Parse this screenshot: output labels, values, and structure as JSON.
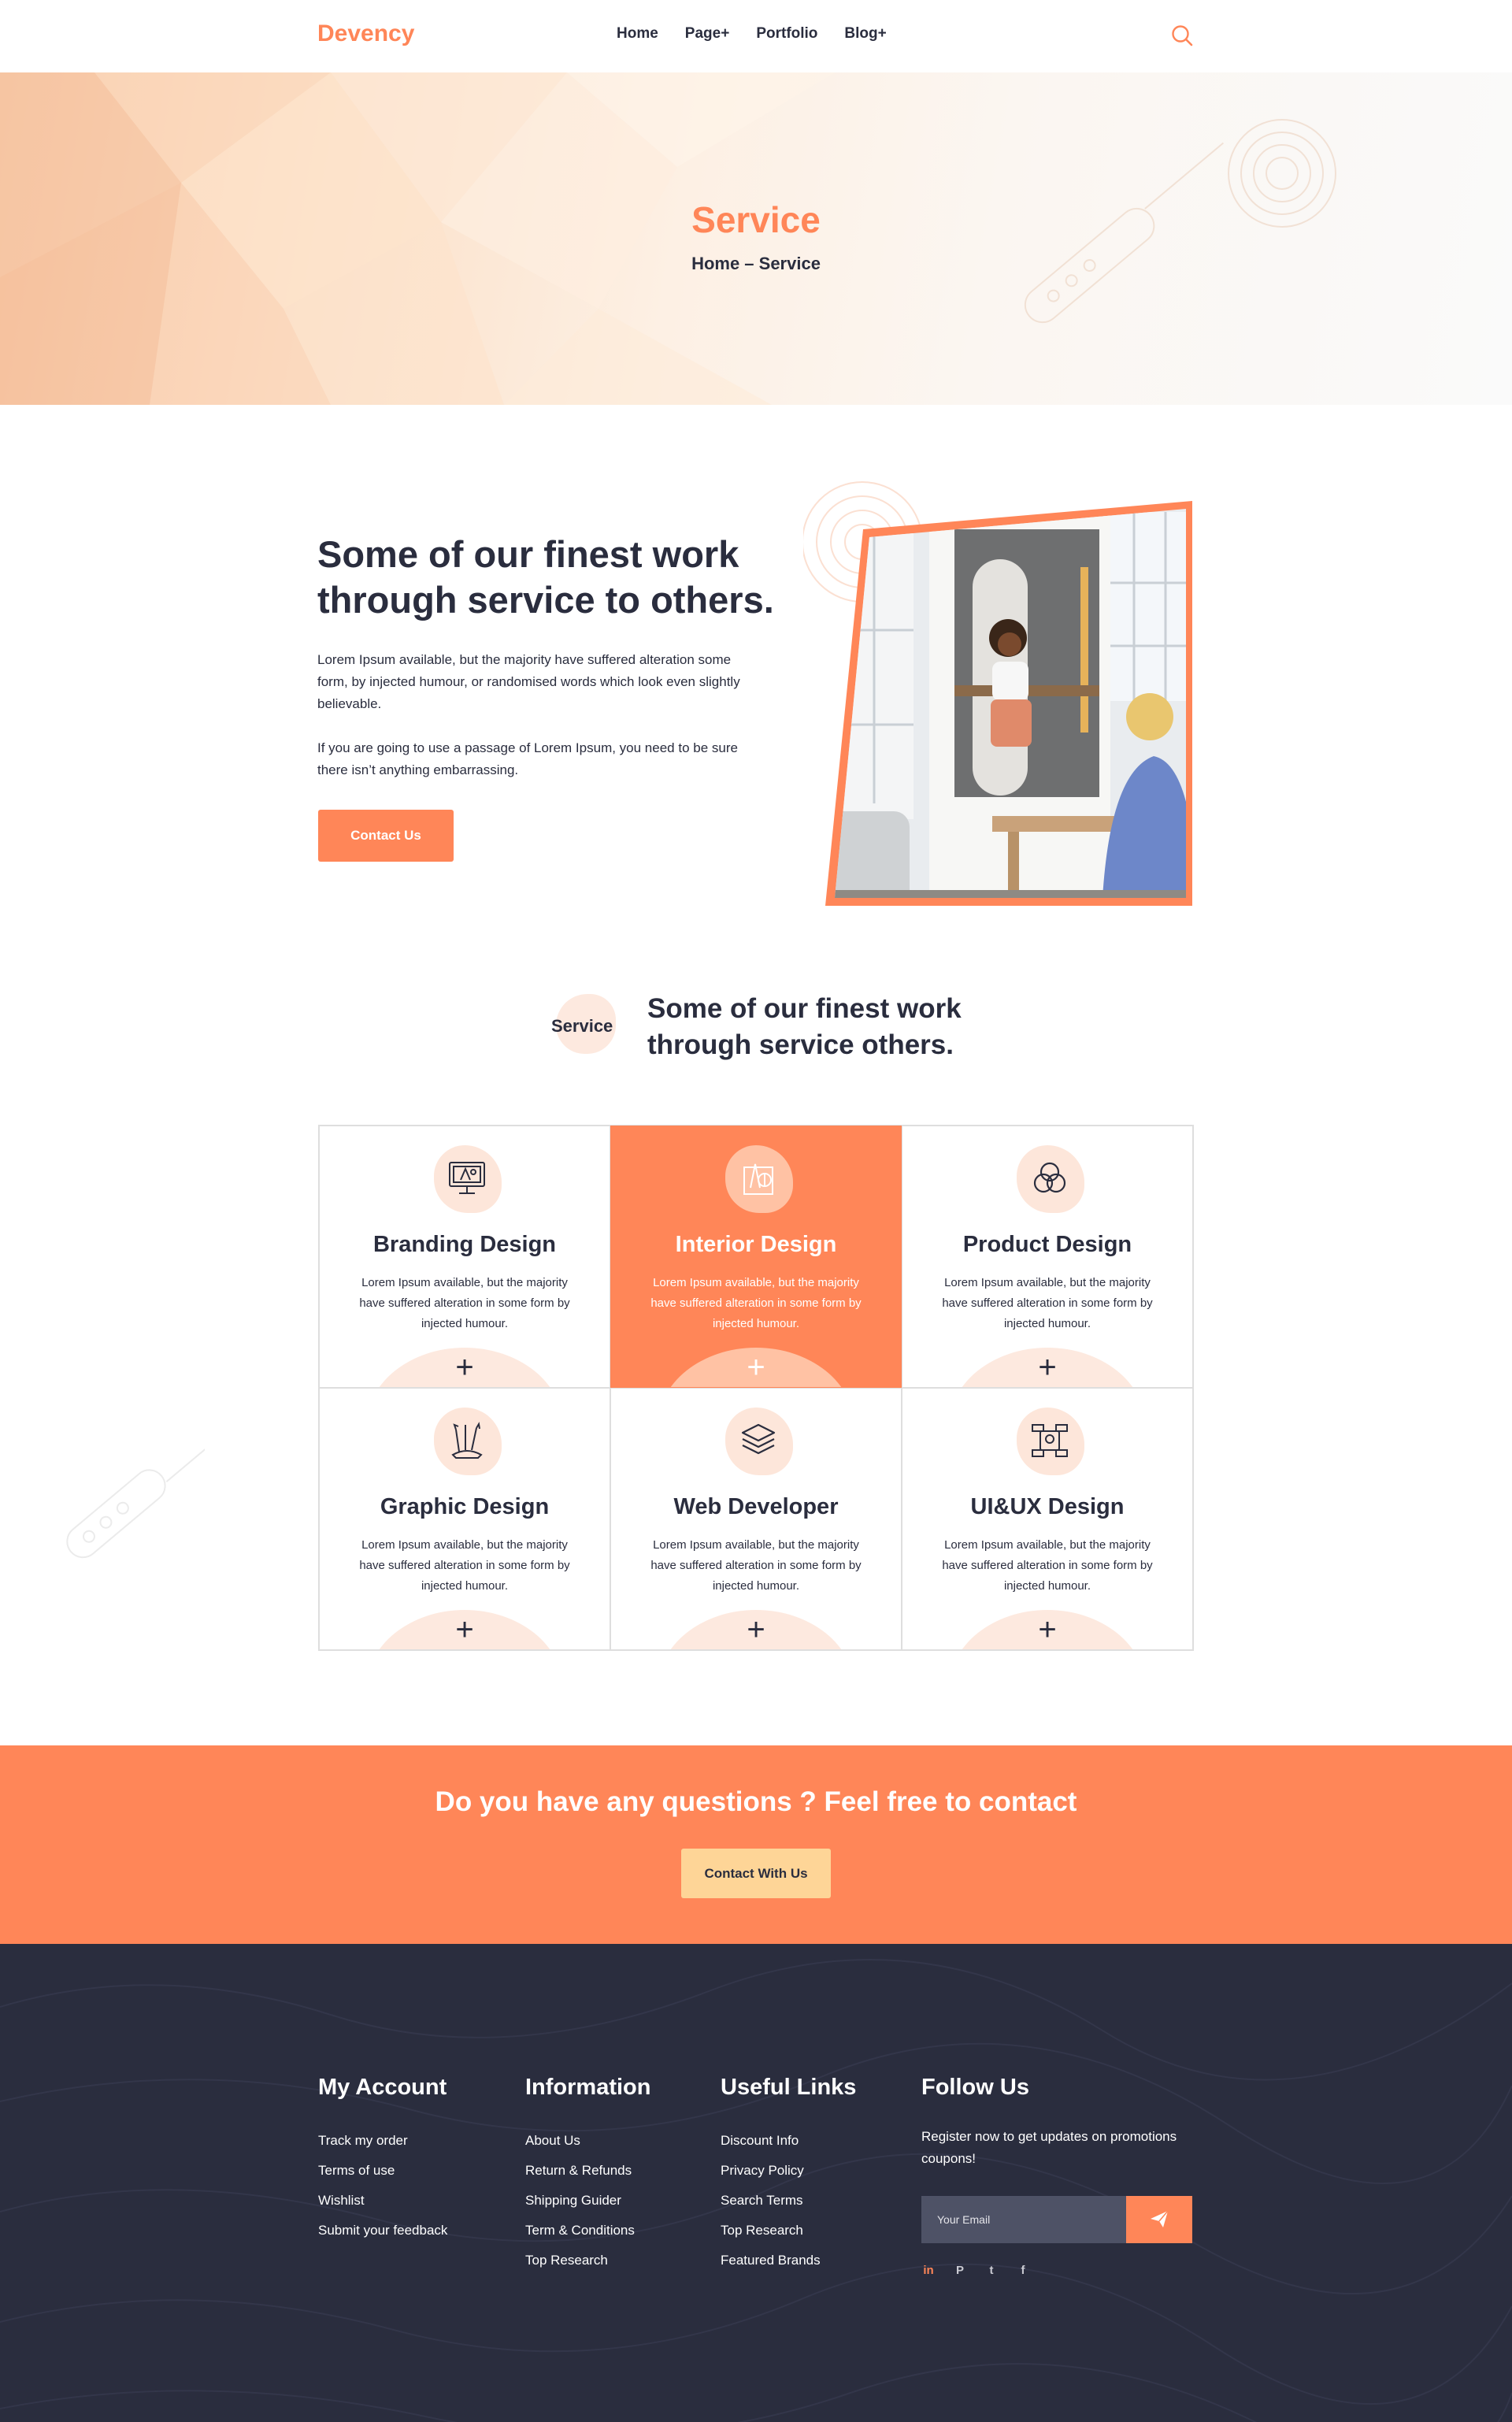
{
  "header": {
    "logo": "Devency",
    "nav": [
      "Home",
      "Page+",
      "Portfolio",
      "Blog+"
    ],
    "search_icon": "search-icon"
  },
  "hero": {
    "title": "Service",
    "breadcrumb": "Home – Service"
  },
  "about": {
    "heading": "Some of our finest work through service to others.",
    "para1": "Lorem Ipsum available, but the majority have suffered alteration some form, by injected humour, or randomised words which look even slightly believable.",
    "para2": "If you are going to use a passage of Lorem Ipsum, you need to be sure there isn’t anything embarrassing.",
    "button": "Contact Us"
  },
  "services": {
    "label": "Service",
    "heading": "Some of our finest work through service others.",
    "cards": [
      {
        "title": "Branding Design",
        "text": "Lorem Ipsum available, but the majority have suffered alteration in some form by injected humour.",
        "icon": "monitor-design-icon",
        "active": false
      },
      {
        "title": "Interior Design",
        "text": "Lorem Ipsum available, but the majority have suffered alteration in some form by injected humour.",
        "icon": "drafting-tools-icon",
        "active": true
      },
      {
        "title": "Product Design",
        "text": "Lorem Ipsum available, but the majority have suffered alteration in some form by injected humour.",
        "icon": "venn-circles-icon",
        "active": false
      },
      {
        "title": "Graphic Design",
        "text": "Lorem Ipsum available, but the majority have suffered alteration in some form by injected humour.",
        "icon": "pencil-cup-icon",
        "active": false
      },
      {
        "title": "Web Developer",
        "text": "Lorem Ipsum available, but the majority have suffered alteration in some form by injected humour.",
        "icon": "layers-icon",
        "active": false
      },
      {
        "title": "UI&UX Design",
        "text": "Lorem Ipsum available, but the majority have suffered alteration in some form by injected humour.",
        "icon": "wireframe-icon",
        "active": false
      }
    ],
    "plus": "+"
  },
  "cta": {
    "heading": "Do you have any questions ? Feel free to contact",
    "button": "Contact With Us"
  },
  "footer": {
    "account": {
      "title": "My Account",
      "items": [
        "Track my order",
        "Terms of use",
        "Wishlist",
        "Submit your feedback"
      ]
    },
    "information": {
      "title": "Information",
      "items": [
        "About Us",
        "Return & Refunds",
        "Shipping Guider",
        "Term & Conditions",
        "Top Research"
      ]
    },
    "useful": {
      "title": "Useful Links",
      "items": [
        "Discount Info",
        "Privacy Policy",
        "Search Terms",
        "Top Research",
        "Featured Brands"
      ]
    },
    "follow": {
      "title": "Follow Us",
      "text": "Register now to get updates on promotions coupons!",
      "email_placeholder": "Your Email",
      "social": [
        {
          "label": "in",
          "icon": "linkedin-icon"
        },
        {
          "label": "P",
          "icon": "pinterest-icon"
        },
        {
          "label": "t",
          "icon": "twitter-icon"
        },
        {
          "label": "f",
          "icon": "facebook-icon"
        }
      ]
    }
  },
  "colors": {
    "accent": "#ff8658",
    "dark": "#2a2d3e",
    "cta_button": "#fed597",
    "blob": "#fde9df"
  }
}
